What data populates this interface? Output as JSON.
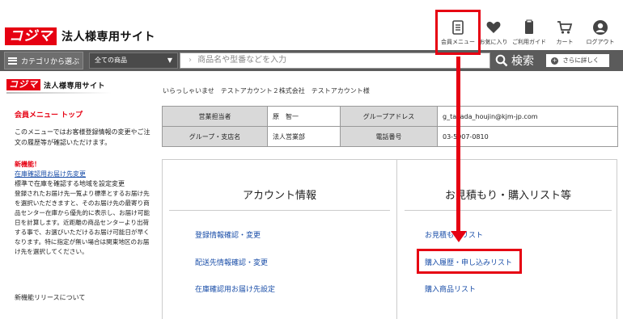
{
  "header": {
    "logo_mark": "コジマ",
    "logo_sub": "法人様専用サイト",
    "nav": [
      {
        "label": "会員メニュー",
        "icon": "member-menu-icon"
      },
      {
        "label": "お気に入り",
        "icon": "heart-icon"
      },
      {
        "label": "ご利用ガイド",
        "icon": "guide-icon"
      },
      {
        "label": "カート",
        "icon": "cart-icon"
      },
      {
        "label": "ログアウト",
        "icon": "user-icon"
      }
    ]
  },
  "searchbar": {
    "category_button": "カテゴリから選ぶ",
    "select_value": "全ての商品",
    "input_placeholder": "商品名や型番などを入力",
    "search_button": "検索",
    "detail_button": "さらに詳しく"
  },
  "sidebar": {
    "logo_mark": "コジマ",
    "logo_sub": "法人様専用サイト",
    "title": "会員メニュー トップ",
    "intro": "このメニューではお客様登録情報の変更やご注文の履歴等が確認いただけます。",
    "new_label": "新機能！",
    "new_link": "在庫確認用お届け先変更",
    "new_lead": "標準で在庫を確認する地域を設定変更",
    "new_body": "登録されたお届け先一覧より標準とするお届け先を選択いただきますと、そのお届け先の最寄り商品センター在庫から優先的に表示し、お届け可能日を計算します。近距離の商品センターより出荷する事で、お選びいただけるお届け可能日が早くなります。特に指定が無い場合は関東地区のお届け先を選択してください。",
    "release": "新機能リリースについて"
  },
  "main": {
    "welcome": "いらっしゃいませ　テストアカウント２株式会社　テストアカウント様",
    "table": {
      "r1c1": "営業担当者",
      "r1c2": "原　智一",
      "r1c3": "グループアドレス",
      "r1c4": "g_takada_houjin@kjm-jp.com",
      "r2c1": "グループ・支店名",
      "r2c2": "法人営業部",
      "r2c3": "電話番号",
      "r2c4": "03-5907-0810"
    },
    "account": {
      "title": "アカウント情報",
      "links": [
        "登録情報確認・変更",
        "配送先情報確認・変更",
        "在庫確認用お届け先設定"
      ]
    },
    "estimate": {
      "title": "お見積もり・購入リスト等",
      "links": [
        "お見積もりリスト",
        "購入履歴・申し込みリスト",
        "購入商品リスト"
      ]
    }
  },
  "colors": {
    "accent": "#e60012",
    "link": "#1a4ea8",
    "bar": "#5b5b5b"
  }
}
